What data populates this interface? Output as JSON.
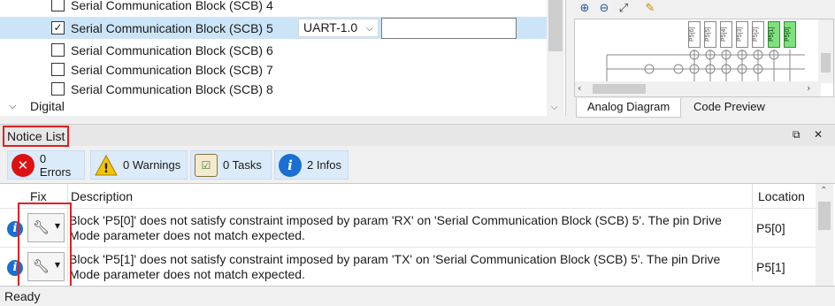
{
  "tree": {
    "rows": [
      {
        "label": "Serial Communication Block (SCB) 4",
        "checked": false
      },
      {
        "label": "Serial Communication Block (SCB) 5",
        "checked": true
      },
      {
        "label": "Serial Communication Block (SCB) 6",
        "checked": false
      },
      {
        "label": "Serial Communication Block (SCB) 7",
        "checked": false
      },
      {
        "label": "Serial Communication Block (SCB) 8",
        "checked": false
      }
    ],
    "selected_select_value": "UART-1.0",
    "selected_name_value": "",
    "digital_label": "Digital"
  },
  "diagram": {
    "pins": [
      "P5[6]",
      "P5[5]",
      "P5[4]",
      "P5[3]",
      "P5[2]",
      "P5[1]",
      "P5[0]"
    ],
    "tabs": [
      "Analog Diagram",
      "Code Preview"
    ],
    "active_tab": "Analog Diagram"
  },
  "notice_list": {
    "title": "Notice List",
    "filters": {
      "errors": "0 Errors",
      "warnings": "0 Warnings",
      "tasks": "0 Tasks",
      "infos": "2 Infos"
    },
    "columns": {
      "fix": "Fix",
      "description": "Description",
      "location": "Location"
    },
    "rows": [
      {
        "description": "Block 'P5[0]' does not satisfy constraint imposed by param 'RX' on 'Serial Communication Block (SCB) 5'. The pin Drive Mode parameter does not match expected.",
        "location": "P5[0]"
      },
      {
        "description": "Block 'P5[1]' does not satisfy constraint imposed by param 'TX' on 'Serial Communication Block (SCB) 5'. The pin Drive Mode parameter does not match expected.",
        "location": "P5[1]"
      }
    ]
  },
  "status": {
    "text": "Ready"
  },
  "colors": {
    "highlight": "#e02020",
    "selected_row": "#cce4f7",
    "pin_active": "#7fe07f",
    "info_blue": "#1a6fd1",
    "error_red": "#dd1111"
  }
}
